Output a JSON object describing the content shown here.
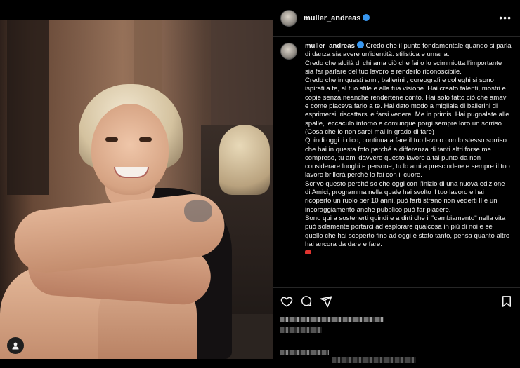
{
  "header": {
    "username": "muller_andreas",
    "more_icon": "more-icon"
  },
  "caption": {
    "username": "muller_andreas",
    "paragraphs": [
      "Credo che il punto fondamentale quando si parla di danza sia avere un'identità: stilistica e umana.",
      "Credo che aldilà di chi ama ciò che fai o lo scimmiotta l'importante sia far parlare del tuo lavoro e renderlo riconoscibile.",
      "Credo che in questi anni, ballerini , coreografi e colleghi si sono ispirati a te, al tuo stile e alla tua visione. Hai creato talenti, mostri e copie senza neanche rendertene conto. Hai solo fatto ciò che amavi e come piaceva farlo a te. Hai dato modo a migliaia di ballerini di esprimersi, riscattarsi e farsi vedere. Me in primis. Hai pugnalate alle spalle, leccaculo intorno e comunque porgi sempre loro un sorriso. (Cosa che io non sarei mai in grado di fare)",
      "Quindi oggi ti dico, continua a fare il tuo lavoro con lo stesso sorriso che hai in questa foto perché a differenza di tanti altri forse me compreso, tu ami davvero questo lavoro a tal punto da non considerare luoghi e persone, tu lo ami a prescindere e sempre il tuo lavoro brillerà perché lo fai con il cuore.",
      "Scrivo questo perché so che oggi con l'inizio di una nuova edizione di Amici, programma nella quale hai svolto il tuo lavoro e hai ricoperto un ruolo per 10 anni, può farti strano non vederti lì e un incoraggiamento anche pubblico può far piacere.",
      "Sono qui a sostenerti quindi e a dirti che il \"cambiamento\" nella vita può solamente portarci ad esplorare qualcosa in più di noi e se quello che hai scoperto fino ad oggi è stato tanto, pensa quanto altro hai ancora da dare e fare."
    ]
  },
  "actions": {
    "like_icon": "heart-icon",
    "comment_icon": "comment-icon",
    "share_icon": "share-icon",
    "save_icon": "bookmark-icon"
  },
  "colors": {
    "background": "#000000",
    "text": "#f0f0f0",
    "verified": "#3897f0",
    "divider": "#262626"
  }
}
